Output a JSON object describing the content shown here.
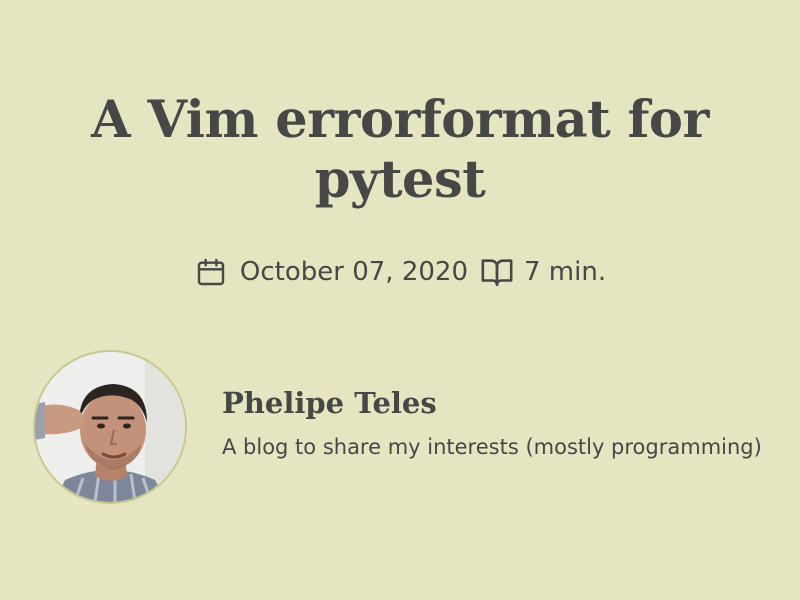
{
  "post": {
    "title": "A Vim errorformat for pytest",
    "date": "October 07, 2020",
    "reading_time": "7 min."
  },
  "author": {
    "name": "Phelipe Teles",
    "bio": "A blog to share my interests (mostly programming)"
  },
  "icons": {
    "date": "calendar-icon",
    "reading_time": "book-open-icon"
  },
  "colors": {
    "background": "#e6e5c1",
    "text": "#474747",
    "avatar_border": "#c7c98c"
  }
}
